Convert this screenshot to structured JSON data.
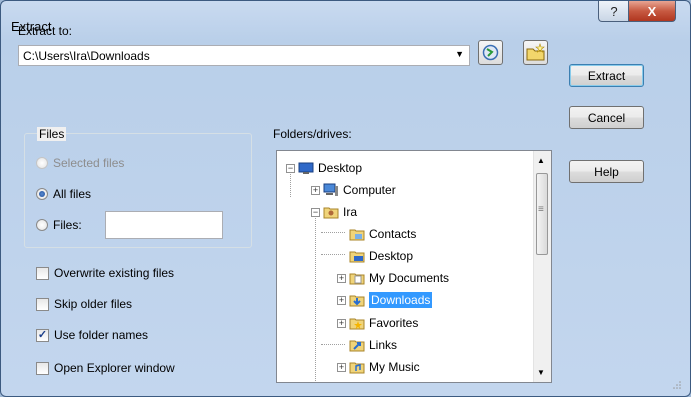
{
  "window": {
    "title": "Extract",
    "help_glyph": "?",
    "close_glyph": "X"
  },
  "extract_to": {
    "label": "Extract to:",
    "path": "C:\\Users\\Ira\\Downloads",
    "arrow": "▼"
  },
  "files_group": {
    "title": "Files",
    "options": [
      {
        "label": "Selected files",
        "selected": false,
        "enabled": false
      },
      {
        "label": "All files",
        "selected": true,
        "enabled": true
      },
      {
        "label": "Files:",
        "selected": false,
        "enabled": true
      }
    ],
    "files_value": ""
  },
  "options": [
    {
      "label": "Overwrite existing files",
      "checked": false
    },
    {
      "label": "Skip older files",
      "checked": false
    },
    {
      "label": "Use folder names",
      "checked": true
    },
    {
      "label": "Open Explorer window",
      "checked": false
    }
  ],
  "check_mark": "✓",
  "folders": {
    "label": "Folders/drives:",
    "tree": [
      {
        "label": "Desktop",
        "expander": "−",
        "icon": "desktop-icon"
      },
      {
        "label": "Computer",
        "expander": "+",
        "icon": "computer-icon"
      },
      {
        "label": "Ira",
        "expander": "−",
        "icon": "user-folder-icon"
      },
      {
        "label": "Contacts",
        "expander": "",
        "icon": "contacts-folder-icon"
      },
      {
        "label": "Desktop",
        "expander": "",
        "icon": "desktop-folder-icon"
      },
      {
        "label": "My Documents",
        "expander": "+",
        "icon": "documents-folder-icon"
      },
      {
        "label": "Downloads",
        "expander": "+",
        "icon": "downloads-folder-icon",
        "selected": true
      },
      {
        "label": "Favorites",
        "expander": "+",
        "icon": "favorites-folder-icon"
      },
      {
        "label": "Links",
        "expander": "",
        "icon": "links-folder-icon"
      },
      {
        "label": "My Music",
        "expander": "+",
        "icon": "music-folder-icon"
      }
    ],
    "scroll_up": "▲",
    "scroll_down": "▼",
    "grip": "≡"
  },
  "buttons": {
    "extract": "Extract",
    "cancel": "Cancel",
    "help": "Help"
  },
  "colors": {
    "selection": "#3399ff",
    "title_bar": "#c9daf0",
    "close_button": "#c75a42"
  }
}
